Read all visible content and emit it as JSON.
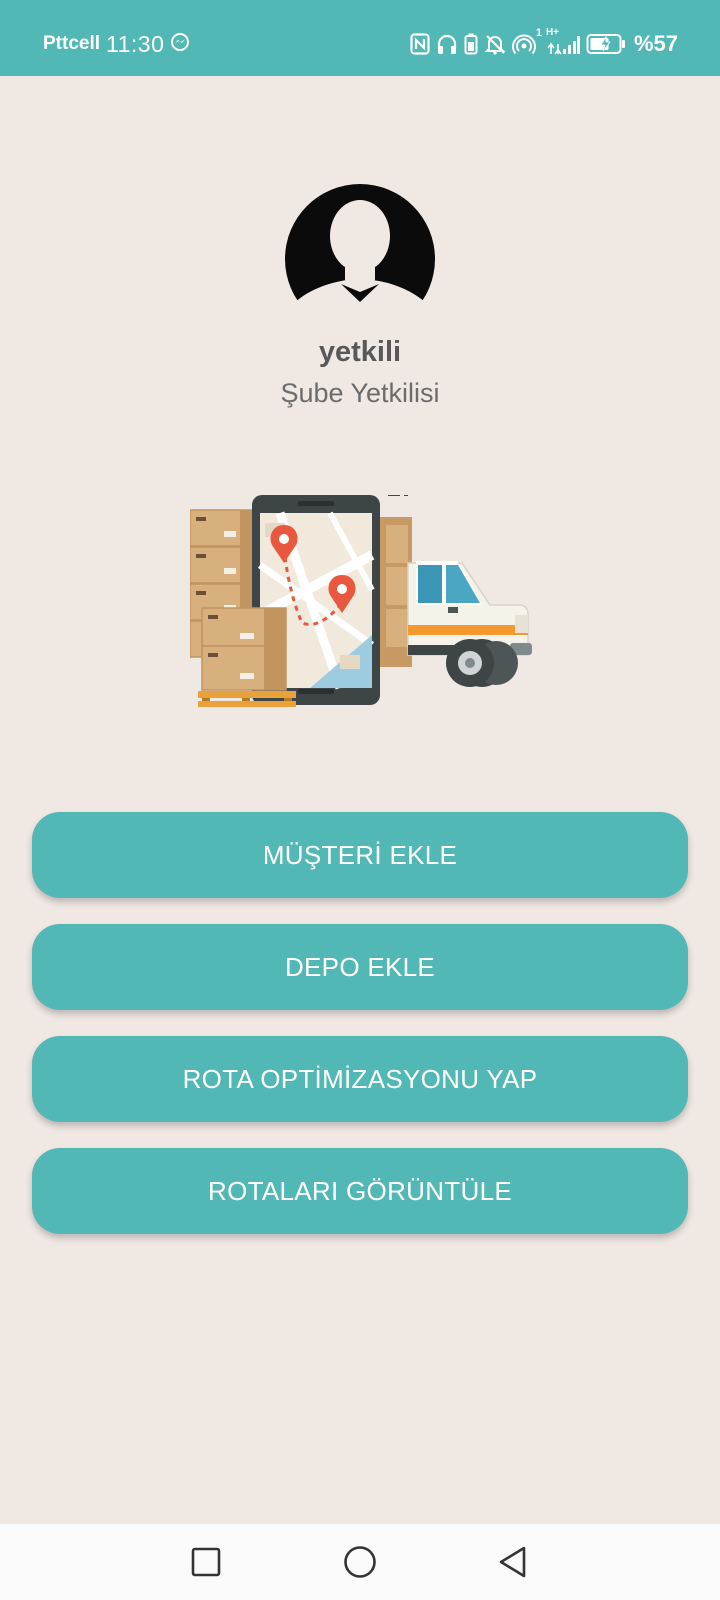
{
  "status_bar": {
    "carrier": "Pttcell",
    "time": "11:30",
    "battery_percent": "%57",
    "sim_indicator": "1",
    "network_type": "H+",
    "icons": [
      "messenger-icon",
      "nfc-icon",
      "headphones-icon",
      "battery-saver-icon",
      "mute-icon",
      "hotspot-icon",
      "signal-icon",
      "battery-icon"
    ]
  },
  "profile": {
    "name": "yetkili",
    "role": "Şube Yetkilisi",
    "avatar_icon": "user-avatar-icon"
  },
  "illustration": {
    "icon": "delivery-map-illustration",
    "colors": {
      "box": "#d7b07e",
      "box_dark": "#c19460",
      "phone": "#3d4547",
      "pin": "#e9573f",
      "truck_stripe": "#f29a2e",
      "map_water": "#9dcbe0"
    }
  },
  "menu": {
    "buttons": [
      {
        "label": "MÜŞTERİ EKLE"
      },
      {
        "label": "DEPO EKLE"
      },
      {
        "label": "ROTA OPTİMİZASYONU YAP"
      },
      {
        "label": "ROTALARI GÖRÜNTÜLE"
      }
    ]
  },
  "nav_bar": {
    "icons": [
      "recents-square-icon",
      "home-circle-icon",
      "back-triangle-icon"
    ]
  },
  "colors": {
    "accent": "#52b8b5",
    "background": "#f0e8e3",
    "nav_background": "#fafafa"
  }
}
